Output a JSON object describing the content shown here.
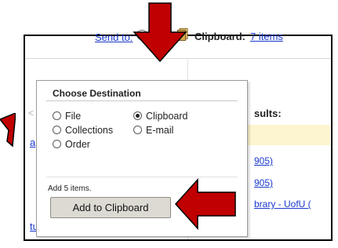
{
  "header": {
    "send_to_label": "Send to:",
    "clipboard_label": "Clipboard:",
    "clipboard_items": "7 items"
  },
  "background": {
    "left_fragment_lt": "<",
    "left_fragment_a": "a",
    "left_fragment_tu": "tu",
    "results_fragment": "sults:",
    "result_1": "905)",
    "result_2": "905)",
    "result_3": "brary - UofU ("
  },
  "popup": {
    "title": "Choose Destination",
    "options": [
      {
        "label": "File",
        "checked": false
      },
      {
        "label": "Clipboard",
        "checked": true
      },
      {
        "label": "Collections",
        "checked": false
      },
      {
        "label": "E-mail",
        "checked": false
      },
      {
        "label": "Order",
        "checked": false
      }
    ],
    "add_note": "Add 5 items.",
    "add_button_label": "Add to Clipboard"
  },
  "colors": {
    "arrow_fill": "#c00000",
    "link": "#1a39cc",
    "highlight": "#fdf5cf"
  }
}
